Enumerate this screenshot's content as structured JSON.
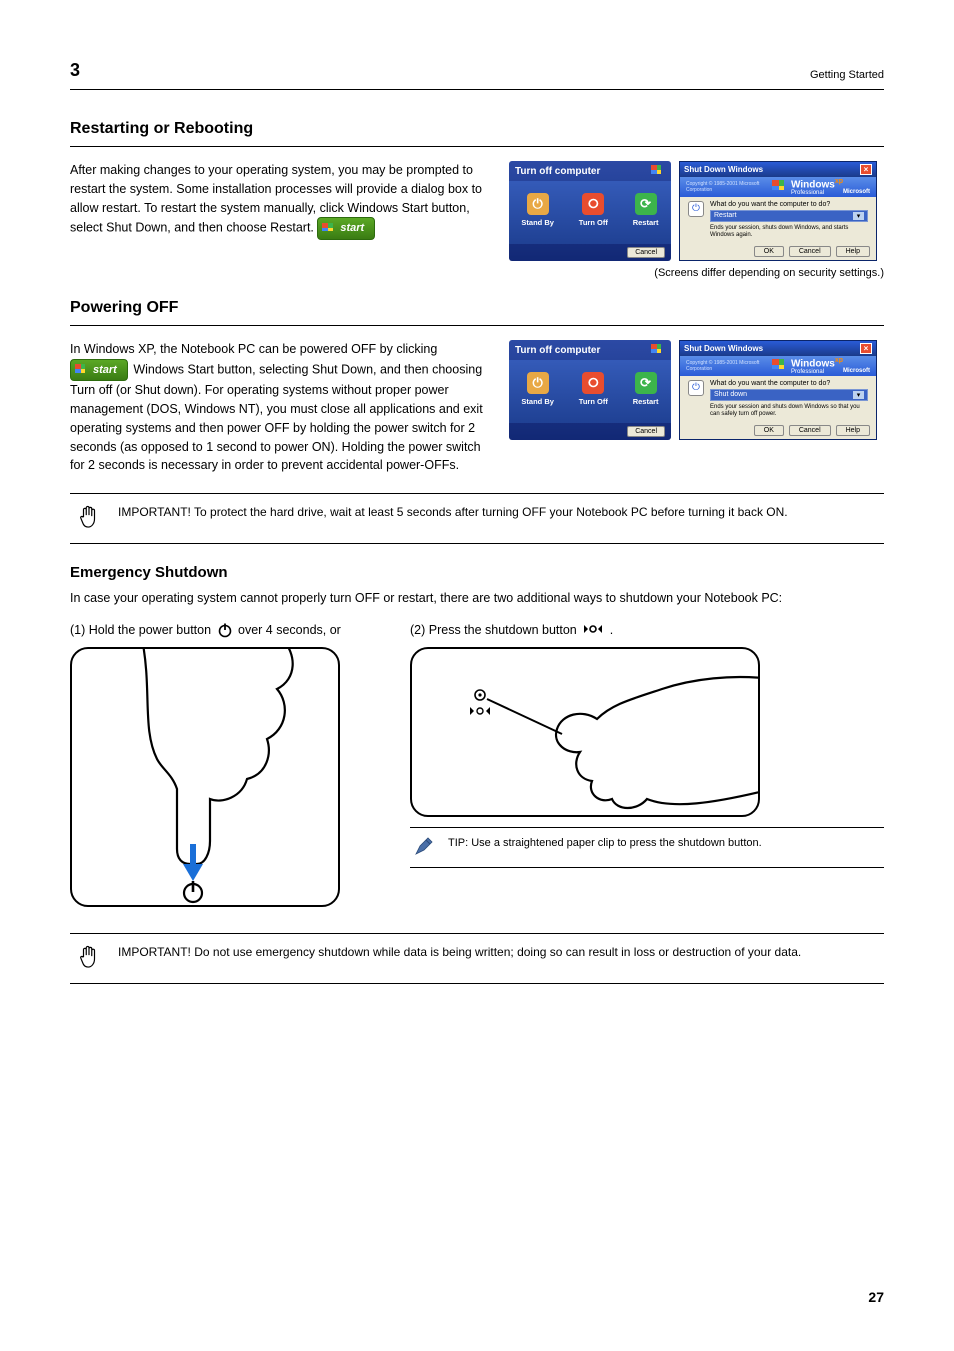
{
  "header": {
    "chapter": "3",
    "chapter_title": "Getting Started",
    "page": "27"
  },
  "restart": {
    "title": "Restarting or Rebooting",
    "body": "After making changes to your operating system, you may be prompted to restart the system. Some installation processes will provide a dialog box to allow restart. To restart the system manually, click Windows Start button, select Shut Down, and then choose Restart.",
    "start_label": "start",
    "screens_caption": "(Screens differ depending on security settings.)"
  },
  "xp_blue": {
    "title": "Turn off computer",
    "standby": "Stand By",
    "turnoff": "Turn Off",
    "restart": "Restart",
    "cancel": "Cancel"
  },
  "xp_classic": {
    "title": "Shut Down Windows",
    "logo_main": "Windows",
    "logo_xp": "xp",
    "logo_sub": "Professional",
    "ms": "Microsoft",
    "copyright": "Copyright © 1985-2001 Microsoft Corporation",
    "ask": "What do you want the computer to do?",
    "opt_restart": "Restart",
    "opt_shutdown": "Shut down",
    "desc_restart": "Ends your session, shuts down Windows, and starts Windows again.",
    "desc_shutdown": "Ends your session and shuts down Windows so that you can safely turn off power.",
    "ok": "OK",
    "cancel": "Cancel",
    "help": "Help"
  },
  "poweroff": {
    "title": "Powering OFF",
    "body1": "In Windows XP, the Notebook PC can be powered OFF by clicking ",
    "body2": " Windows Start button, selecting Shut Down, and then choosing Turn off (or Shut down). For operating systems without proper power management (DOS, Windows NT), you must close all applications and exit operating systems and then power OFF by holding the power switch for 2 seconds (as opposed to 1 second to power ON). Holding the power switch for 2 seconds is necessary in order to prevent accidental power-OFFs.",
    "start_label": "start"
  },
  "important": {
    "text": "IMPORTANT! To protect the hard drive, wait at least 5 seconds after turning OFF your Notebook PC before turning it back ON."
  },
  "emergency": {
    "title": "Emergency Shutdown",
    "body": "In case your operating system cannot properly turn OFF or restart, there are two additional ways to shutdown your Notebook PC:",
    "opt1_a": "(1) Hold the power button ",
    "opt1_b": " over 4 seconds, or",
    "opt2_a": "(2) Press the shutdown button ",
    "opt2_b": "."
  },
  "tip": {
    "text": "TIP: Use a straightened paper clip to press the shutdown button."
  },
  "important2": {
    "text": "IMPORTANT! Do not use emergency shutdown while data is being written; doing so can result in loss or destruction of your data."
  }
}
